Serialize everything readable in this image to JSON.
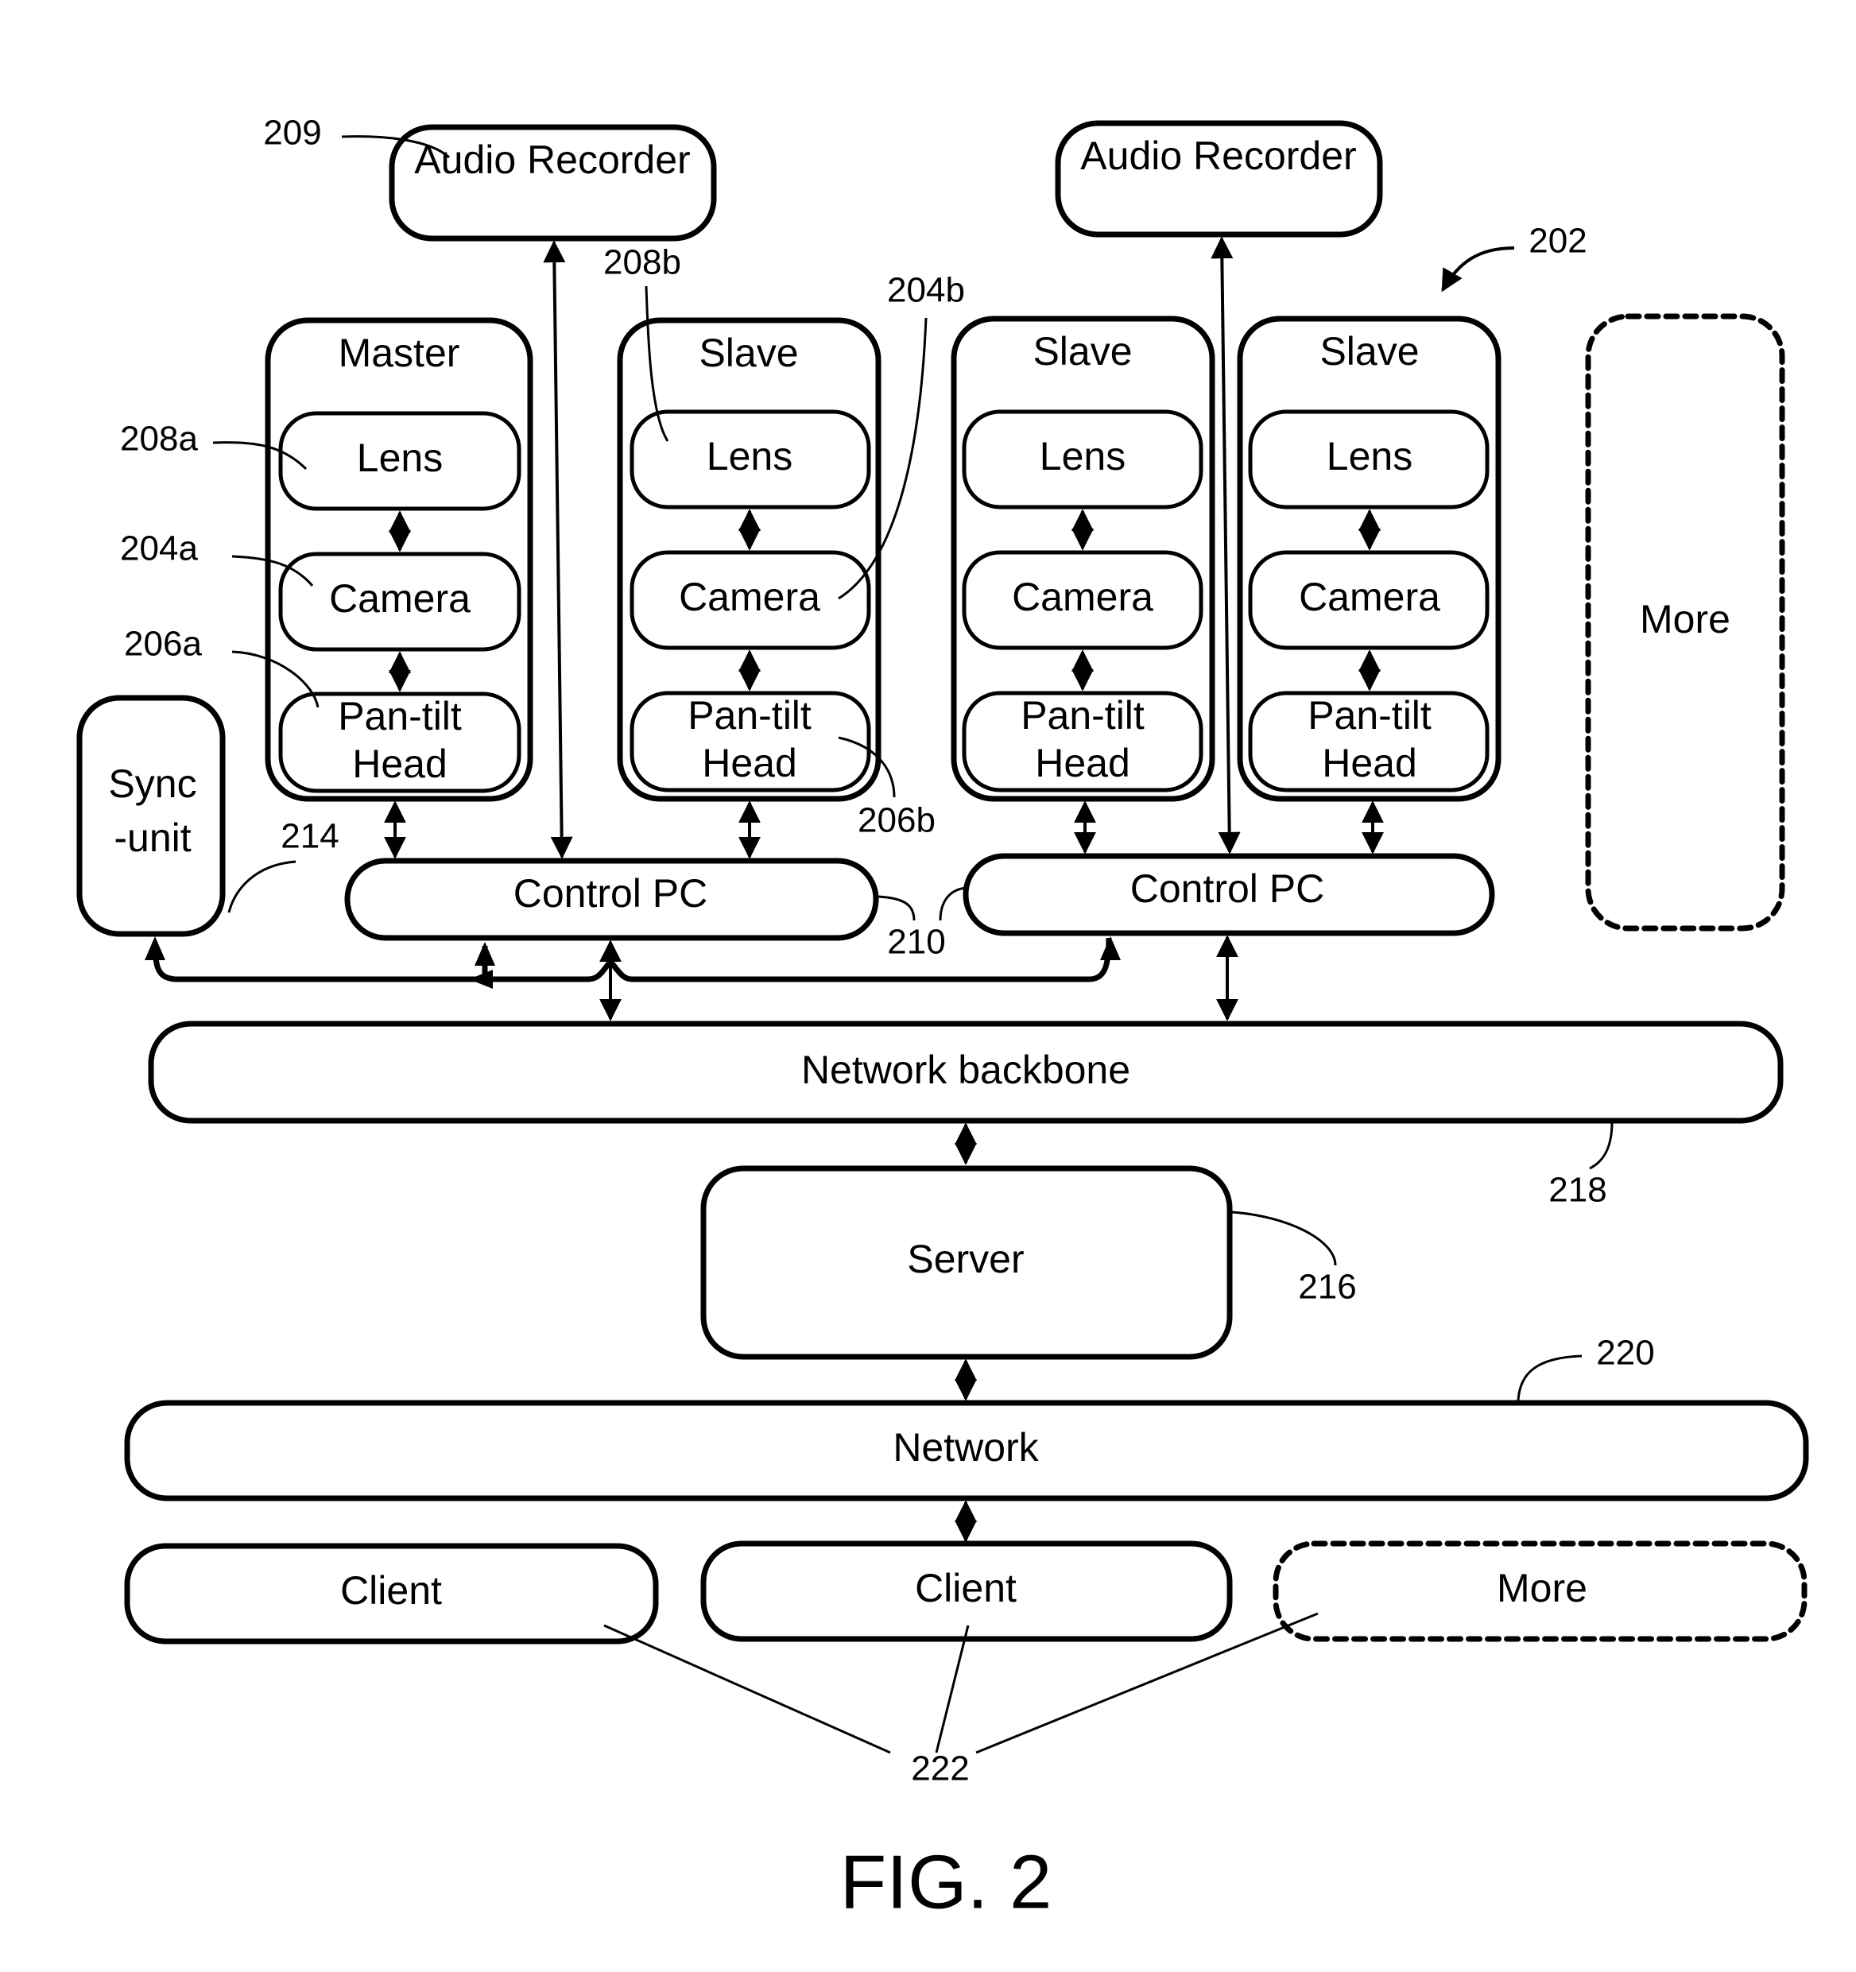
{
  "figure": {
    "caption": "FIG. 2",
    "system_ref": "202"
  },
  "audio_recorders": [
    {
      "label": "Audio Recorder",
      "ref": "209"
    },
    {
      "label": "Audio Recorder",
      "ref": ""
    }
  ],
  "camera_units": [
    {
      "role": "Master",
      "lens": "Lens",
      "camera": "Camera",
      "head_line1": "Pan-tilt",
      "head_line2": "Head",
      "lens_ref": "208a",
      "camera_ref": "204a",
      "head_ref": "206a"
    },
    {
      "role": "Slave",
      "lens": "Lens",
      "camera": "Camera",
      "head_line1": "Pan-tilt",
      "head_line2": "Head",
      "lens_ref": "208b",
      "camera_ref": "204b",
      "head_ref": "206b"
    },
    {
      "role": "Slave",
      "lens": "Lens",
      "camera": "Camera",
      "head_line1": "Pan-tilt",
      "head_line2": "Head"
    },
    {
      "role": "Slave",
      "lens": "Lens",
      "camera": "Camera",
      "head_line1": "Pan-tilt",
      "head_line2": "Head"
    }
  ],
  "more_units": {
    "label": "More"
  },
  "sync_unit": {
    "line1": "Sync",
    "line2": "-unit",
    "ref": "214"
  },
  "control_pcs": [
    {
      "label": "Control PC"
    },
    {
      "label": "Control PC"
    }
  ],
  "control_pc_ref": "210",
  "network_backbone": {
    "label": "Network backbone",
    "ref": "218"
  },
  "server": {
    "label": "Server",
    "ref": "216"
  },
  "network": {
    "label": "Network",
    "ref": "220"
  },
  "clients": [
    {
      "label": "Client"
    },
    {
      "label": "Client"
    },
    {
      "label": "More"
    }
  ],
  "clients_ref": "222"
}
